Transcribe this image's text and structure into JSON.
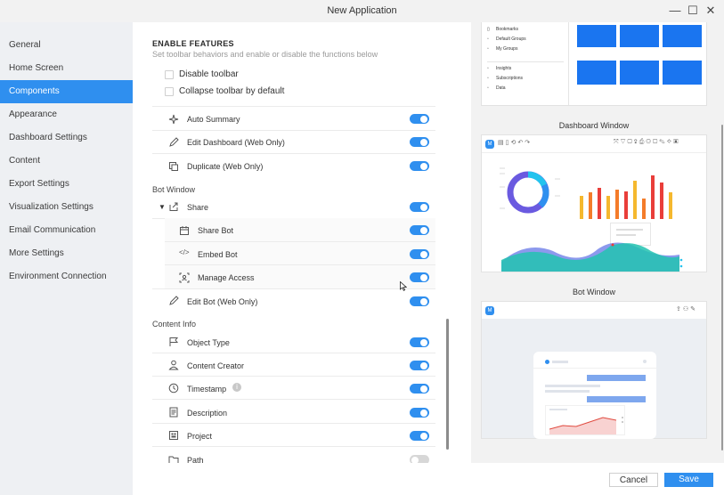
{
  "window": {
    "title": "New Application"
  },
  "sidebar": {
    "items": [
      {
        "label": "General"
      },
      {
        "label": "Home Screen"
      },
      {
        "label": "Components"
      },
      {
        "label": "Appearance"
      },
      {
        "label": "Dashboard Settings"
      },
      {
        "label": "Content"
      },
      {
        "label": "Export Settings"
      },
      {
        "label": "Visualization Settings"
      },
      {
        "label": "Email Communication"
      },
      {
        "label": "More Settings"
      },
      {
        "label": "Environment Connection"
      }
    ],
    "active": "Components"
  },
  "features": {
    "heading": "ENABLE FEATURES",
    "subtitle": "Set toolbar behaviors and enable or disable the functions below",
    "checkboxes": [
      {
        "label": "Disable toolbar",
        "checked": false
      },
      {
        "label": "Collapse toolbar by default",
        "checked": false
      }
    ],
    "toolbar_items": [
      {
        "label": "Auto Summary",
        "icon": "sparkle-icon",
        "on": true
      },
      {
        "label": "Edit Dashboard (Web Only)",
        "icon": "pencil-icon",
        "on": true
      },
      {
        "label": "Duplicate (Web Only)",
        "icon": "duplicate-icon",
        "on": true
      }
    ],
    "bot_window": {
      "heading": "Bot Window",
      "share": {
        "label": "Share",
        "icon": "share-icon",
        "on": true
      },
      "share_children": [
        {
          "label": "Share Bot",
          "icon": "calendar-icon",
          "on": true
        },
        {
          "label": "Embed Bot",
          "icon": "code-icon",
          "on": true
        },
        {
          "label": "Manage Access",
          "icon": "manage-access-icon",
          "on": true
        }
      ],
      "edit_bot": {
        "label": "Edit Bot (Web Only)",
        "icon": "pencil-icon",
        "on": true
      }
    },
    "content_info": {
      "heading": "Content Info",
      "items": [
        {
          "label": "Object Type",
          "icon": "flag-icon",
          "on": true
        },
        {
          "label": "Content Creator",
          "icon": "person-icon",
          "on": true
        },
        {
          "label": "Timestamp",
          "icon": "clock-icon",
          "on": true,
          "info": true
        },
        {
          "label": "Description",
          "icon": "document-icon",
          "on": true
        },
        {
          "label": "Project",
          "icon": "project-icon",
          "on": true
        },
        {
          "label": "Path",
          "icon": "folder-icon",
          "on": false
        }
      ]
    }
  },
  "preview": {
    "library_items": [
      "Bookmarks",
      "Default Groups",
      "My Groups",
      "Insights",
      "Subscriptions",
      "Data"
    ],
    "dashboard_title": "Dashboard Window",
    "bot_title": "Bot Window"
  },
  "footer": {
    "cancel_label": "Cancel",
    "save_label": "Save"
  },
  "colors": {
    "accent": "#2f8fef",
    "sidebar_bg": "#eef0f3",
    "toggle_off": "#d7d7d7"
  }
}
